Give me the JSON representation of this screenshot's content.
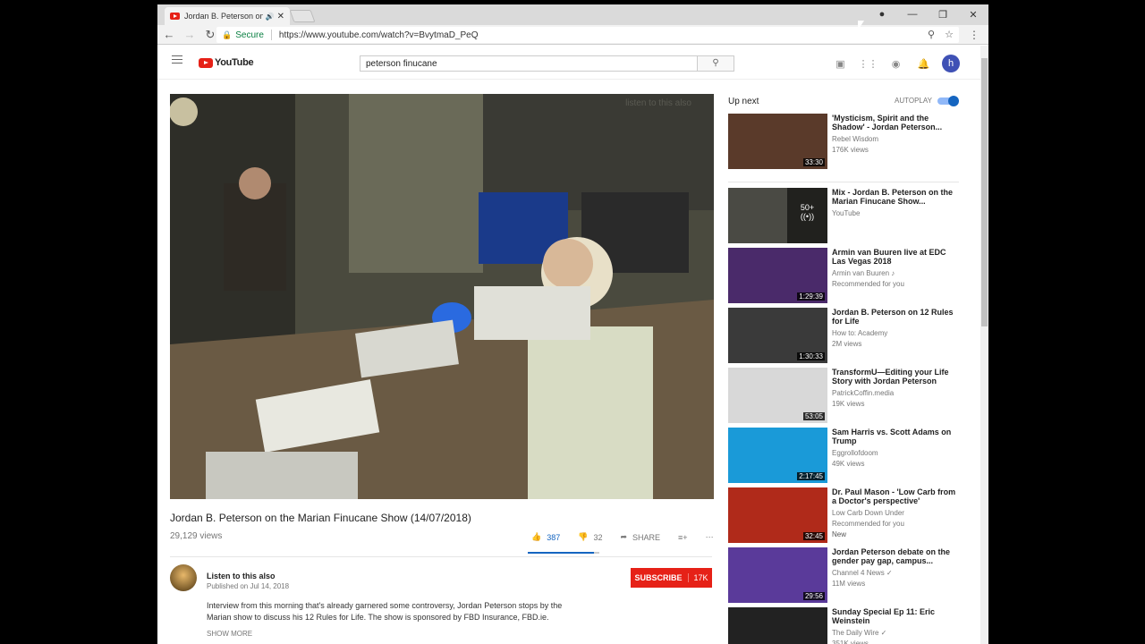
{
  "browser": {
    "tab_title": "Jordan B. Peterson on",
    "tab_audio": "🔊",
    "tab_close": "✕",
    "secure_label": "Secure",
    "url": "https://www.youtube.com/watch?v=BvytmaD_PeQ",
    "win_min": "—",
    "win_restore": "❐",
    "win_close": "✕",
    "back": "←",
    "forward": "→",
    "reload": "↻"
  },
  "youtube": {
    "logo_text": "YouTube",
    "search_value": "peterson finucane",
    "avatar_letter": "h"
  },
  "video": {
    "overlay_text": "listen to this also",
    "title": "Jordan B. Peterson on the Marian Finucane Show (14/07/2018)",
    "views": "29,129 views",
    "likes": "387",
    "dislikes": "32",
    "share": "SHARE",
    "like_ratio": 0.92,
    "channel": "Listen to this also",
    "published": "Published on Jul 14, 2018",
    "subscribe": "SUBSCRIBE",
    "subscribers": "17K",
    "description": "Interview from this morning that's already garnered some controversy, Jordan Peterson stops by the Marian show to discuss his 12 Rules for Life. The show is sponsored by FBD Insurance, FBD.ie.",
    "show_more": "SHOW MORE"
  },
  "sidebar": {
    "up_next": "Up next",
    "autoplay": "AUTOPLAY",
    "items": [
      {
        "title": "'Mysticism, Spirit and the Shadow' - Jordan Peterson...",
        "channel": "Rebel Wisdom",
        "views": "176K views",
        "duration": "33:30",
        "color": "#5a3a2a"
      },
      {
        "title": "Mix - Jordan B. Peterson on the Marian Finucane Show...",
        "channel": "YouTube",
        "views": "",
        "duration": "",
        "mix": "50+",
        "color": "#4a4a44"
      },
      {
        "title": "Armin van Buuren live at EDC Las Vegas 2018",
        "channel": "Armin van Buuren ♪",
        "views": "Recommended for you",
        "duration": "1:29:39",
        "color": "#4a2a6a"
      },
      {
        "title": "Jordan B. Peterson on 12 Rules for Life",
        "channel": "How to: Academy",
        "views": "2M views",
        "duration": "1:30:33",
        "color": "#3a3a3a"
      },
      {
        "title": "TransformU—Editing your Life Story with Jordan Peterson",
        "channel": "PatrickCoffin.media",
        "views": "19K views",
        "duration": "53:05",
        "color": "#d8d8d8"
      },
      {
        "title": "Sam Harris vs. Scott Adams on Trump",
        "channel": "Eggrollofdoom",
        "views": "49K views",
        "duration": "2:17:45",
        "color": "#1a9ad8"
      },
      {
        "title": "Dr. Paul Mason - 'Low Carb from a Doctor's perspective'",
        "channel": "Low Carb Down Under",
        "views": "Recommended for you",
        "extra": "New",
        "duration": "32:45",
        "color": "#b02a1a"
      },
      {
        "title": "Jordan Peterson debate on the gender pay gap, campus...",
        "channel": "Channel 4 News ✓",
        "views": "11M views",
        "duration": "29:56",
        "color": "#5a3a9a"
      },
      {
        "title": "Sunday Special Ep 11: Eric Weinstein",
        "channel": "The Daily Wire ✓",
        "views": "351K views",
        "duration": "",
        "color": "#222"
      }
    ]
  }
}
